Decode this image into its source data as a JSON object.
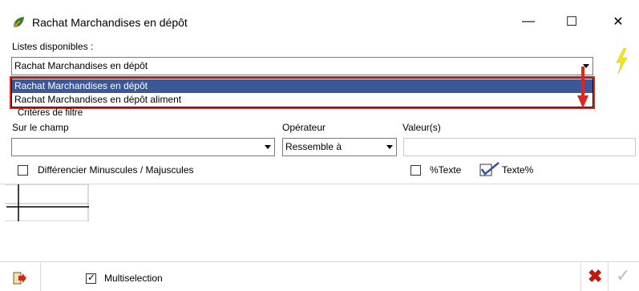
{
  "window": {
    "title": "Rachat Marchandises en dépôt",
    "minimize_glyph": "—",
    "maximize_glyph": "☐",
    "close_glyph": "✕",
    "icon": "app-leaf-icon"
  },
  "lists": {
    "label": "Listes disponibles :",
    "selected": "Rachat Marchandises en dépôt",
    "options": [
      "Rachat Marchandises en dépôt",
      "Rachat Marchandises en dépôt aliment"
    ],
    "highlighted_index": 0
  },
  "filter": {
    "group_label": "Critères de filtre",
    "field_label": "Sur le champ",
    "field_value": "",
    "operator_label": "Opérateur",
    "operator_value": "Ressemble à",
    "value_label": "Valeur(s)",
    "value_value": "",
    "case_label": "Différencier Minuscules / Majuscules",
    "case_checked": false,
    "pct_text_label": "%Texte",
    "pct_text_checked": false,
    "text_pct_label": "Texte%",
    "text_pct_checked": true
  },
  "footer": {
    "multiselection_label": "Multiselection",
    "multiselection_checked": true,
    "check_glyph": "✓",
    "cancel_glyph": "✖",
    "ok_glyph": "✓"
  },
  "colors": {
    "selection_bg": "#3b5998",
    "annotation_red": "#e0261c",
    "bolt_yellow": "#f5e51f"
  }
}
